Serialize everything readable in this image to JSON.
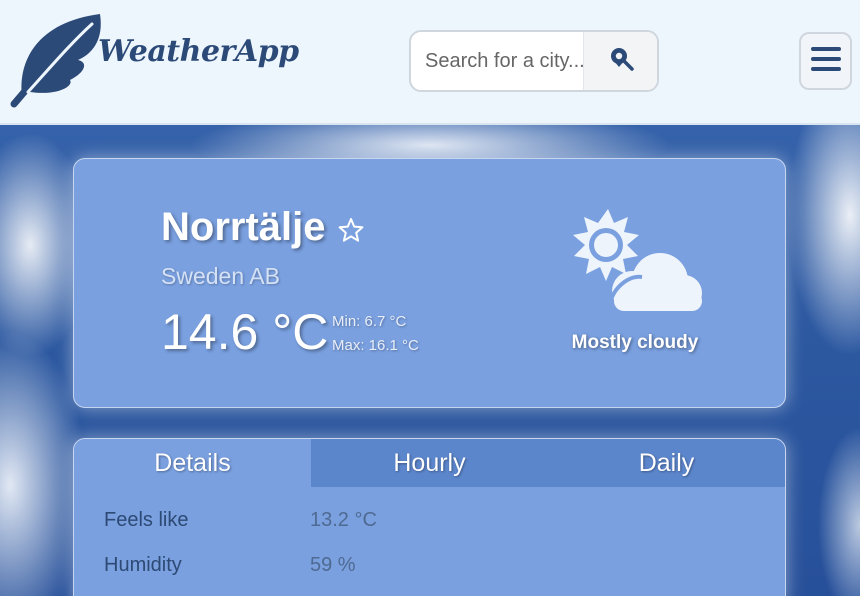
{
  "header": {
    "app_name": "WeatherApp",
    "search": {
      "placeholder": "Search for a city..."
    },
    "icons": {
      "logo": "feather-icon",
      "search": "location-search-icon",
      "menu": "hamburger-menu-icon"
    }
  },
  "current": {
    "city": "Norrtälje",
    "country": "Sweden AB",
    "temperature": "14.6 °C",
    "min": "Min: 6.7 °C",
    "max": "Max: 16.1 °C",
    "condition": "Mostly cloudy",
    "condition_icon": "partly-cloudy-icon"
  },
  "tabs": [
    {
      "label": "Details",
      "active": true
    },
    {
      "label": "Hourly",
      "active": false
    },
    {
      "label": "Daily",
      "active": false
    }
  ],
  "details": [
    {
      "label": "Feels like",
      "value": "13.2 °C"
    },
    {
      "label": "Humidity",
      "value": "59 %"
    }
  ],
  "colors": {
    "header_bg": "#eef6fd",
    "brand": "#2c4a78",
    "card_bg": "#7aa0e0",
    "tab_inactive": "#5c86cc"
  }
}
